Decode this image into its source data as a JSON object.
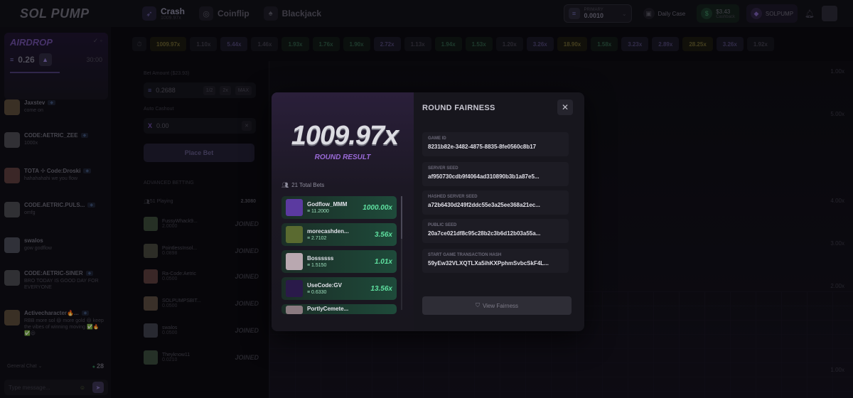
{
  "logo": "SOL PUMP",
  "games": [
    {
      "name": "Crash",
      "sub": "1009.97x",
      "icon": "rocket-icon"
    },
    {
      "name": "Coinflip",
      "sub": "",
      "icon": "coin-icon"
    },
    {
      "name": "Blackjack",
      "sub": "",
      "icon": "cards-icon"
    }
  ],
  "header": {
    "balance_label": "PRIMARY",
    "balance_value": "0.0010",
    "daily_case": "Daily Case",
    "cashback_value": "$3.43",
    "cashback_label": "Cashback",
    "token_label": "SOLPUMP"
  },
  "airdrop": {
    "title": "AIRDROP",
    "amount": "0.26",
    "timer": "30:00"
  },
  "chat": {
    "messages": [
      {
        "name": "Jaxstev",
        "text": "come on"
      },
      {
        "name": "CODE:AETRIC_ZEE",
        "text": "1000x"
      },
      {
        "name": "TOTA ✢ Code:Droski",
        "text": "hahahahahi we you flow"
      },
      {
        "name": "CODE.AETRIC.PULS...",
        "text": "omfg"
      },
      {
        "name": "swalos",
        "text": "gow godflow"
      },
      {
        "name": "CODE:AETRIC-SINER",
        "text": "BRO TODAY IS GOOD DAY FOR EVERYONE"
      },
      {
        "name": "Activecharacter🔥...",
        "text": "RBB more sol 😃 more gold 😃 keep the vibes of winning moving ✅🔥✅😃"
      }
    ],
    "channel": "General Chat",
    "online": "28",
    "placeholder": "Type message..."
  },
  "history": [
    "1009.97x",
    "1.10x",
    "5.44x",
    "1.46x",
    "1.93x",
    "1.76x",
    "1.90x",
    "2.72x",
    "1.13x",
    "1.94x",
    "1.53x",
    "1.20x",
    "3.26x",
    "18.90x",
    "1.58x",
    "3.23x",
    "2.89x",
    "28.25x",
    "3.26x",
    "1.92x"
  ],
  "bet": {
    "amount_label": "Bet Amount ($23.93)",
    "amount": "0.2688",
    "half": "1/2",
    "double": "2x",
    "max": "MAX",
    "auto_label": "Auto Cashout",
    "auto_value": "0.00",
    "place_label": "Place Bet",
    "advanced": "ADVANCED BETTING",
    "playing_label": "51 Playing",
    "playing_total": "2.3080"
  },
  "players": [
    {
      "name": "FussyWhack9...",
      "value": "2.0000",
      "status": "JOINED"
    },
    {
      "name": "PointlessInsol...",
      "value": "0.0898",
      "status": "JOINED"
    },
    {
      "name": "Ra-Code:Aetric",
      "value": "0.0500",
      "status": "JOINED"
    },
    {
      "name": "SOLPUMPSBIT...",
      "value": "0.0500",
      "status": "JOINED"
    },
    {
      "name": "swalos",
      "value": "0.0500",
      "status": "JOINED"
    },
    {
      "name": "Theyknow11",
      "value": "0.0210",
      "status": "JOINED"
    }
  ],
  "game": {
    "y_ticks": [
      "1.00x",
      "5.00x",
      "4.00x",
      "3.00x",
      "2.00x",
      "1.00x"
    ]
  },
  "modal": {
    "multiplier": "1009.97x",
    "result_label": "ROUND RESULT",
    "total_bets": "21 Total Bets",
    "bets": [
      {
        "name": "Godflow_MMM",
        "value": "11.2000",
        "mult": "1000.00x"
      },
      {
        "name": "morecashden...",
        "value": "2.7102",
        "mult": "3.56x"
      },
      {
        "name": "Bossssss",
        "value": "1.5150",
        "mult": "1.01x"
      },
      {
        "name": "UseCode:GV",
        "value": "0.6330",
        "mult": "13.56x"
      },
      {
        "name": "PortlyCemete...",
        "value": "",
        "mult": ""
      }
    ],
    "fairness_title": "ROUND FAIRNESS",
    "fields": [
      {
        "label": "GAME ID",
        "value": "8231b82e-3482-4875-8835-8fe0560c8b17"
      },
      {
        "label": "SERVER SEED",
        "value": "af950730cdb9f4064ad310890b3b1a87e5..."
      },
      {
        "label": "HASHED SERVER SEED",
        "value": "a72b6430d249f2ddc55e3a25ee368a21ec..."
      },
      {
        "label": "PUBLIC SEED",
        "value": "20a7ce021df8c95c28b2c3b6d12b03a55a..."
      },
      {
        "label": "START GAME TRANSACTION HASH",
        "value": "59yEw32VLXQTLXa5ihKXPphmSvbcSkF4L..."
      }
    ],
    "view_button": "View Fairness"
  }
}
